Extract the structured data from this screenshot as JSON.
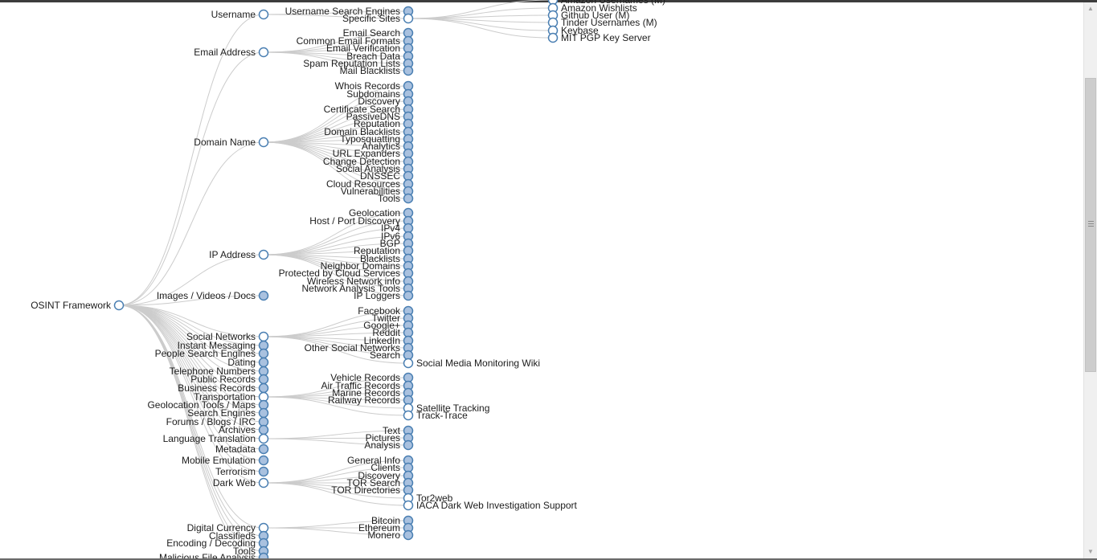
{
  "colors": {
    "link": "#cccccc",
    "node_stroke": "#4a7fb2",
    "node_collapsed_fill": "#a9c1df",
    "node_expanded_fill": "#ffffff",
    "text": "#1c1c1c"
  },
  "tree": {
    "name": "OSINT Framework",
    "open": true,
    "children": [
      {
        "name": "Username",
        "open": true,
        "children": [
          {
            "name": "Username Search Engines"
          },
          {
            "name": "Specific Sites",
            "open": true,
            "children": [
              {
                "name": "Amazon Usernames (M)",
                "open": true
              },
              {
                "name": "Amazon Wishlists",
                "open": true
              },
              {
                "name": "Github User (M)",
                "open": true
              },
              {
                "name": "Tinder Usernames (M)",
                "open": true
              },
              {
                "name": "Keybase",
                "open": true
              },
              {
                "name": "MIT PGP Key Server",
                "open": true
              }
            ]
          }
        ]
      },
      {
        "name": "Email Address",
        "open": true,
        "children": [
          {
            "name": "Email Search"
          },
          {
            "name": "Common Email Formats"
          },
          {
            "name": "Email Verification"
          },
          {
            "name": "Breach Data"
          },
          {
            "name": "Spam Reputation Lists"
          },
          {
            "name": "Mail Blacklists"
          }
        ]
      },
      {
        "name": "Domain Name",
        "open": true,
        "children": [
          {
            "name": "Whois Records"
          },
          {
            "name": "Subdomains"
          },
          {
            "name": "Discovery"
          },
          {
            "name": "Certificate Search"
          },
          {
            "name": "PassiveDNS"
          },
          {
            "name": "Reputation"
          },
          {
            "name": "Domain Blacklists"
          },
          {
            "name": "Typosquatting"
          },
          {
            "name": "Analytics"
          },
          {
            "name": "URL Expanders"
          },
          {
            "name": "Change Detection"
          },
          {
            "name": "Social Analysis"
          },
          {
            "name": "DNSSEC"
          },
          {
            "name": "Cloud Resources"
          },
          {
            "name": "Vulnerabilities"
          },
          {
            "name": "Tools"
          }
        ]
      },
      {
        "name": "IP Address",
        "open": true,
        "children": [
          {
            "name": "Geolocation"
          },
          {
            "name": "Host / Port Discovery"
          },
          {
            "name": "IPv4"
          },
          {
            "name": "IPv6"
          },
          {
            "name": "BGP"
          },
          {
            "name": "Reputation"
          },
          {
            "name": "Blacklists"
          },
          {
            "name": "Neighbor Domains"
          },
          {
            "name": "Protected by Cloud Services"
          },
          {
            "name": "Wireless Network info"
          },
          {
            "name": "Network Analysis Tools"
          },
          {
            "name": "IP Loggers"
          }
        ]
      },
      {
        "name": "Images / Videos / Docs"
      },
      {
        "name": "Social Networks",
        "open": true,
        "children": [
          {
            "name": "Facebook"
          },
          {
            "name": "Twitter"
          },
          {
            "name": "Google+"
          },
          {
            "name": "Reddit"
          },
          {
            "name": "LinkedIn"
          },
          {
            "name": "Other Social Networks"
          },
          {
            "name": "Search"
          },
          {
            "name": "Social Media Monitoring Wiki",
            "open": true
          }
        ]
      },
      {
        "name": "Instant Messaging"
      },
      {
        "name": "People Search Engines"
      },
      {
        "name": "Dating"
      },
      {
        "name": "Telephone Numbers"
      },
      {
        "name": "Public Records"
      },
      {
        "name": "Business Records"
      },
      {
        "name": "Transportation",
        "open": true,
        "children": [
          {
            "name": "Vehicle Records"
          },
          {
            "name": "Air Traffic Records"
          },
          {
            "name": "Marine Records"
          },
          {
            "name": "Railway Records"
          },
          {
            "name": "Satellite Tracking",
            "open": true
          },
          {
            "name": "Track-Trace",
            "open": true
          }
        ]
      },
      {
        "name": "Geolocation Tools / Maps"
      },
      {
        "name": "Search Engines"
      },
      {
        "name": "Forums / Blogs / IRC"
      },
      {
        "name": "Archives"
      },
      {
        "name": "Language Translation",
        "open": true,
        "children": [
          {
            "name": "Text"
          },
          {
            "name": "Pictures"
          },
          {
            "name": "Analysis"
          }
        ]
      },
      {
        "name": "Metadata"
      },
      {
        "name": "Mobile Emulation"
      },
      {
        "name": "Terrorism"
      },
      {
        "name": "Dark Web",
        "open": true,
        "children": [
          {
            "name": "General Info"
          },
          {
            "name": "Clients"
          },
          {
            "name": "Discovery"
          },
          {
            "name": "TOR Search"
          },
          {
            "name": "TOR Directories"
          },
          {
            "name": "Tor2web",
            "open": true
          },
          {
            "name": "IACA Dark Web Investigation Support",
            "open": true
          }
        ]
      },
      {
        "name": "Digital Currency",
        "open": true,
        "children": [
          {
            "name": "Bitcoin"
          },
          {
            "name": "Ethereum"
          },
          {
            "name": "Monero"
          }
        ]
      },
      {
        "name": "Classifieds"
      },
      {
        "name": "Encoding / Decoding"
      },
      {
        "name": "Tools"
      },
      {
        "name": "Malicious File Analysis"
      }
    ]
  }
}
